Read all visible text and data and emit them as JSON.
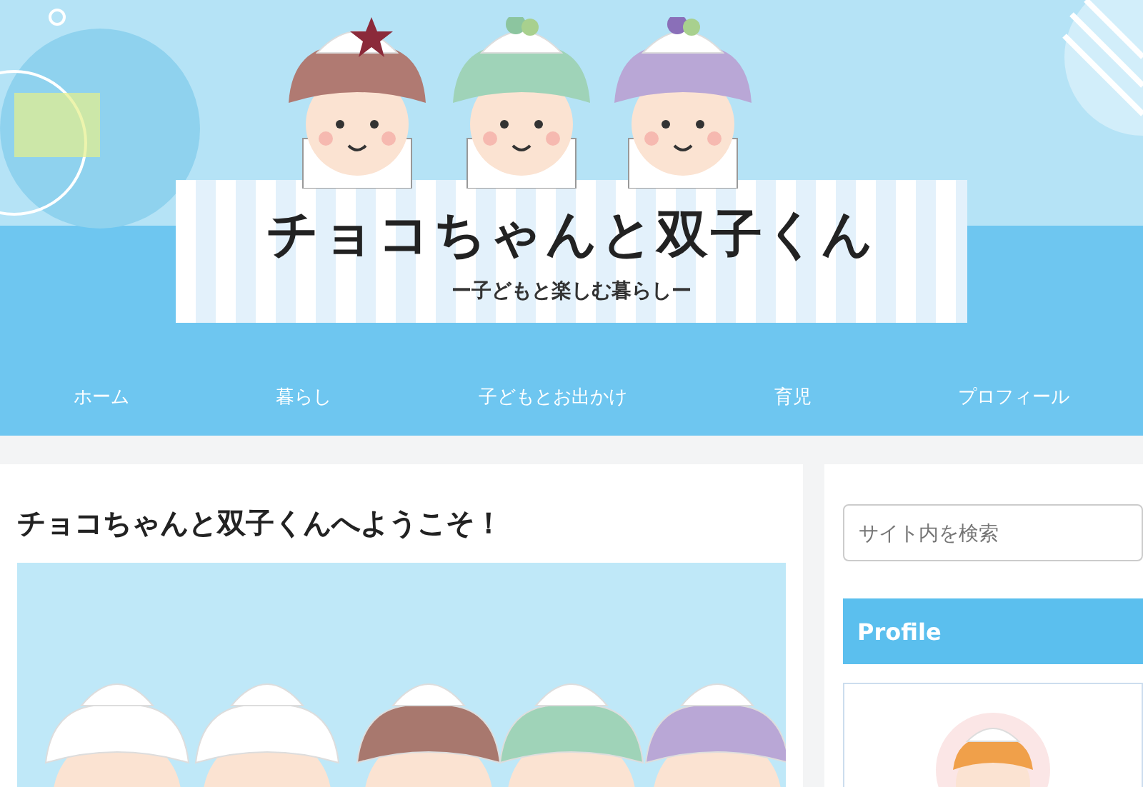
{
  "site": {
    "title": "チョコちゃんと双子くん",
    "tagline": "ー子どもと楽しむ暮らしー"
  },
  "nav": [
    {
      "label": "ホーム"
    },
    {
      "label": "暮らし"
    },
    {
      "label": "子どもとお出かけ"
    },
    {
      "label": "育児"
    },
    {
      "label": "プロフィール"
    }
  ],
  "article": {
    "title": "チョコちゃんと双子くんへようこそ！"
  },
  "sidebar": {
    "search": {
      "placeholder": "サイト内を検索"
    },
    "profile": {
      "heading": "Profile"
    }
  }
}
